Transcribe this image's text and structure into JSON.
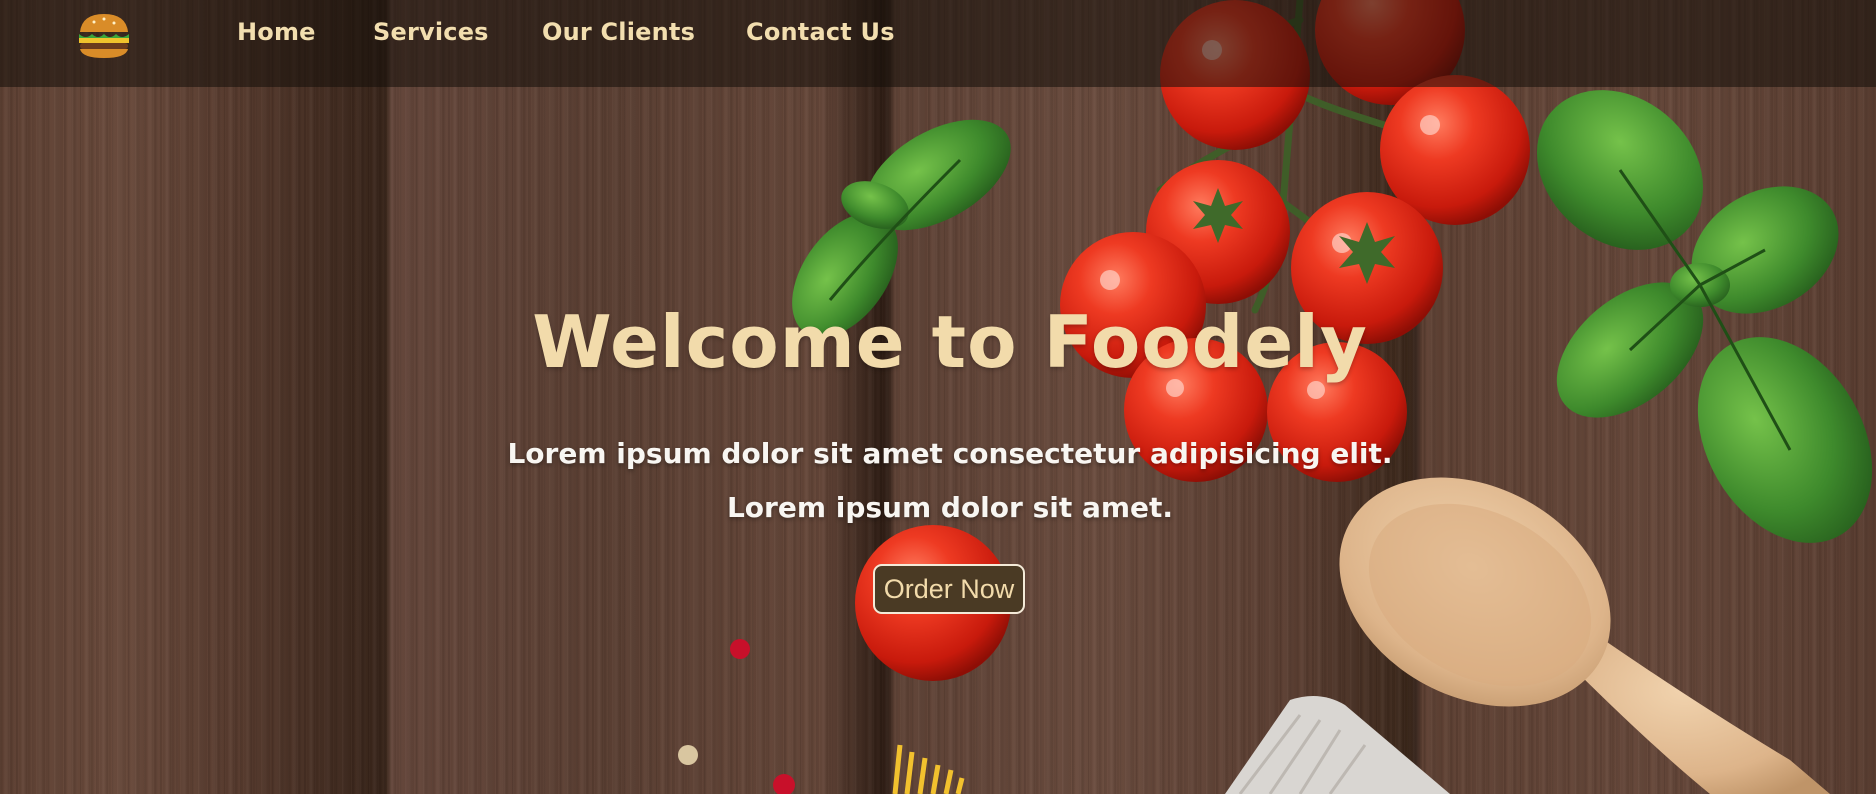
{
  "nav": {
    "logo_icon": "burger-icon",
    "items": [
      {
        "label": "Home"
      },
      {
        "label": "Services"
      },
      {
        "label": "Our Clients"
      },
      {
        "label": "Contact Us"
      }
    ]
  },
  "hero": {
    "title": "Welcome to Foodely",
    "subtitle_line1": "Lorem ipsum dolor sit amet consectetur adipisicing elit.",
    "subtitle_line2": "Lorem ipsum dolor sit amet.",
    "cta_label": "Order Now"
  },
  "colors": {
    "accent": "#f2dbab",
    "button_bg": "#4a3a24",
    "wood": "#5e4032",
    "tomato": "#e02a1a",
    "basil": "#3e8a2c"
  }
}
